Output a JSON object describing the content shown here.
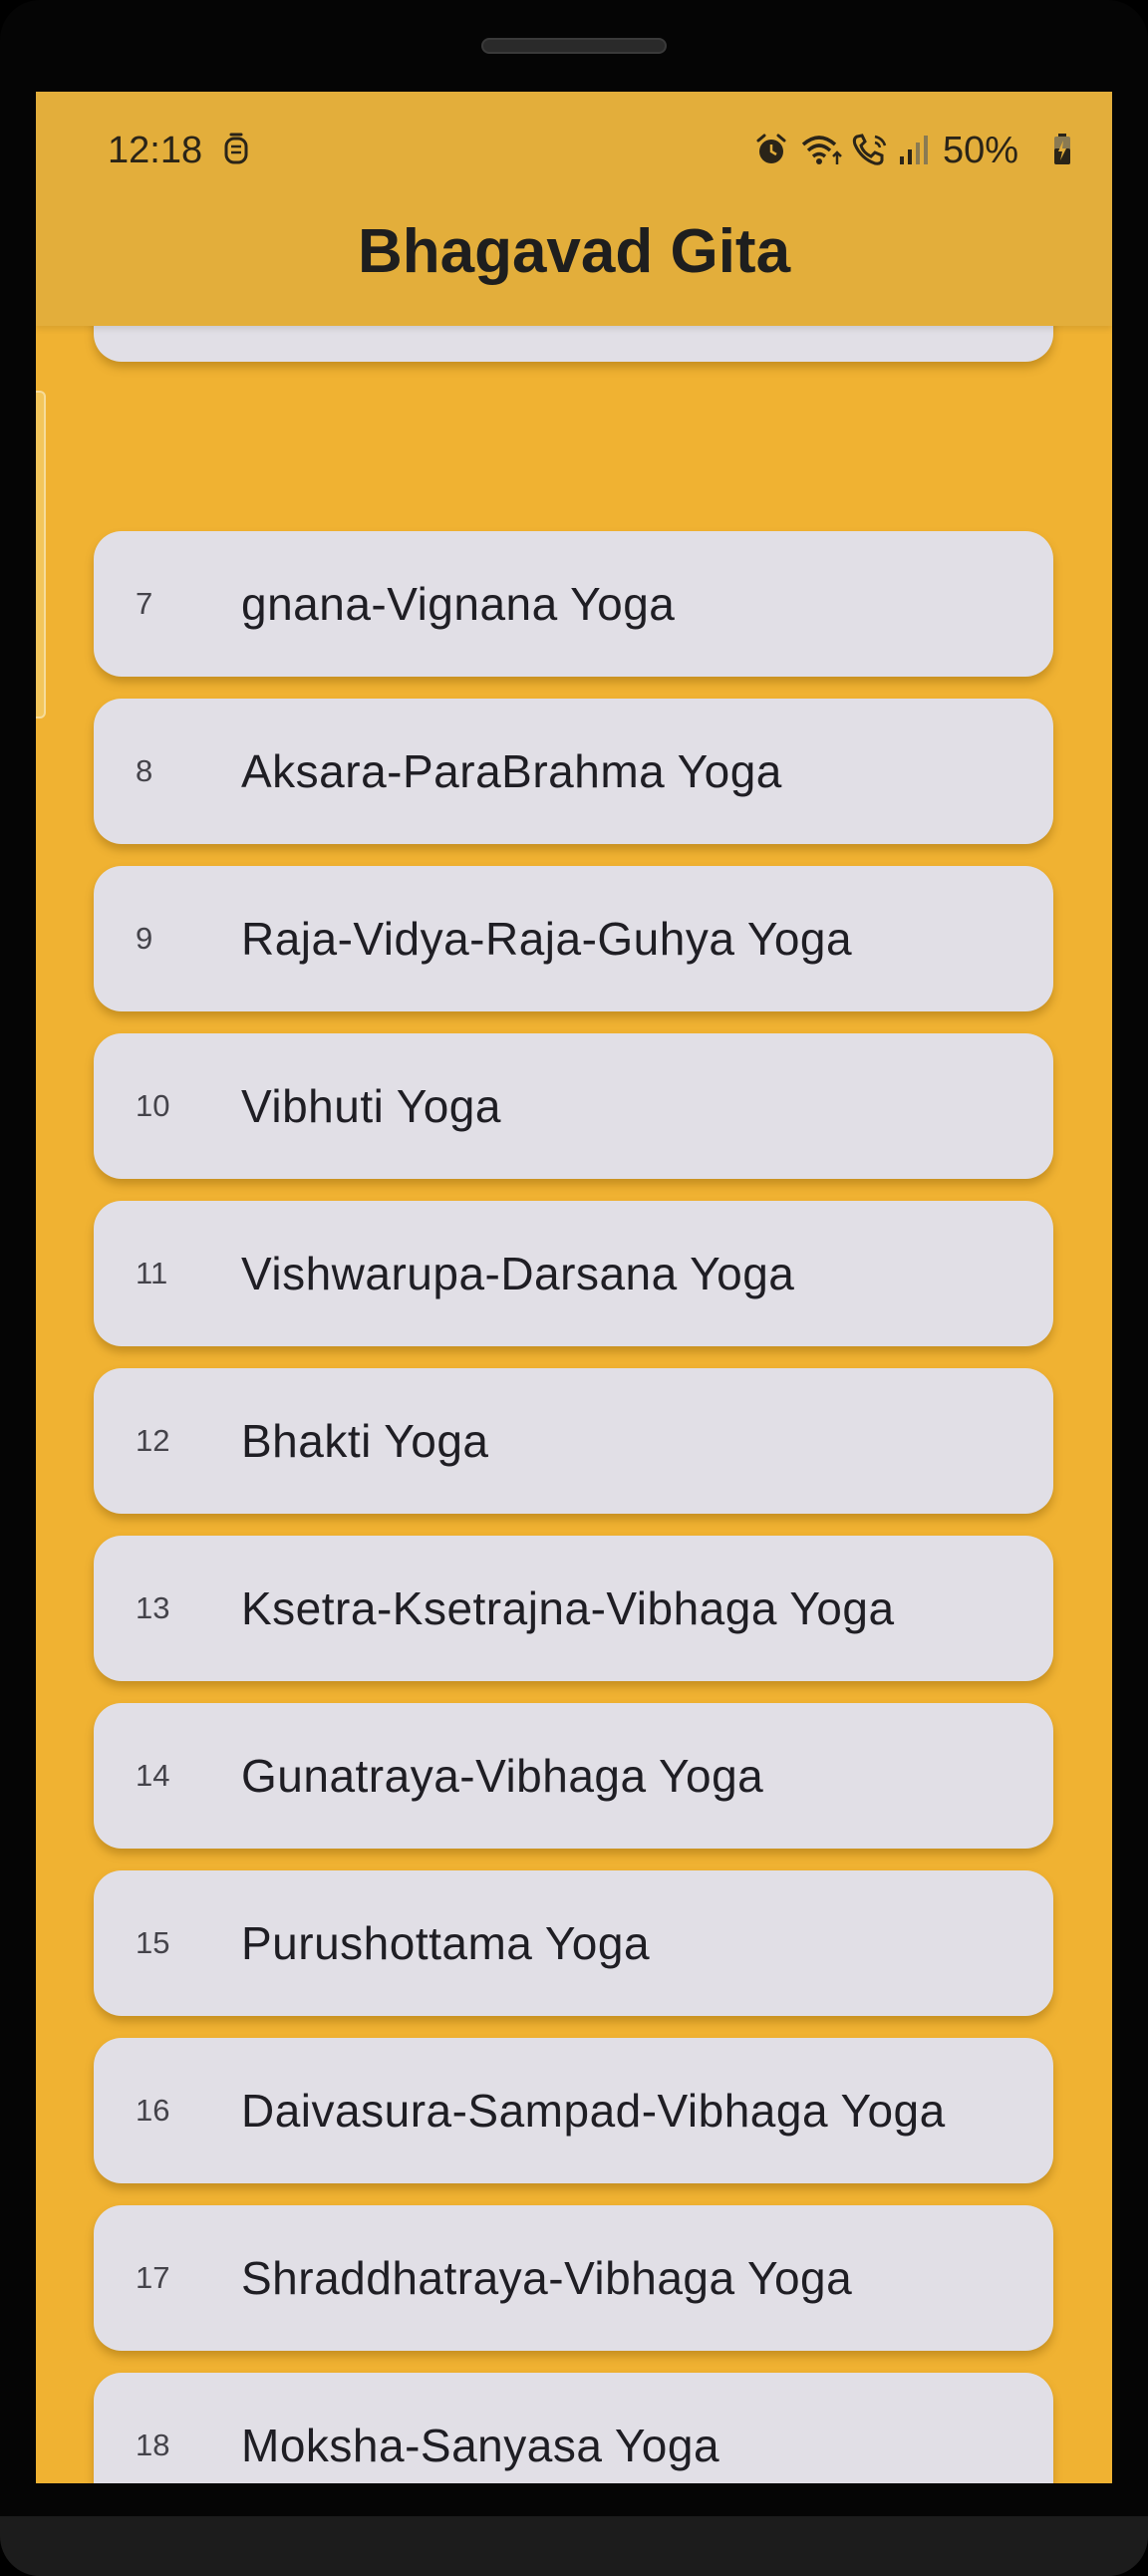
{
  "status_bar": {
    "time": "12:18",
    "battery": "50%",
    "icons": [
      "notification-icon",
      "alarm-icon",
      "wifi-call-icon",
      "call-icon",
      "signal-icon",
      "battery-charging-icon"
    ]
  },
  "app": {
    "title": "Bhagavad Gita"
  },
  "colors": {
    "background": "#F0B232",
    "appbar": "#E3AE3B",
    "card": "#E1DFE6"
  },
  "chapters": [
    {
      "number": "",
      "name": ""
    },
    {
      "number": "7",
      "name": "gnana-Vignana Yoga"
    },
    {
      "number": "8",
      "name": "Aksara-ParaBrahma Yoga"
    },
    {
      "number": "9",
      "name": "Raja-Vidya-Raja-Guhya Yoga"
    },
    {
      "number": "10",
      "name": "Vibhuti Yoga"
    },
    {
      "number": "11",
      "name": "Vishwarupa-Darsana Yoga"
    },
    {
      "number": "12",
      "name": "Bhakti Yoga"
    },
    {
      "number": "13",
      "name": "Ksetra-Ksetrajna-Vibhaga Yoga"
    },
    {
      "number": "14",
      "name": "Gunatraya-Vibhaga Yoga"
    },
    {
      "number": "15",
      "name": "Purushottama Yoga"
    },
    {
      "number": "16",
      "name": "Daivasura-Sampad-Vibhaga Yoga"
    },
    {
      "number": "17",
      "name": "Shraddhatraya-Vibhaga Yoga"
    },
    {
      "number": "18",
      "name": "Moksha-Sanyasa Yoga"
    }
  ]
}
